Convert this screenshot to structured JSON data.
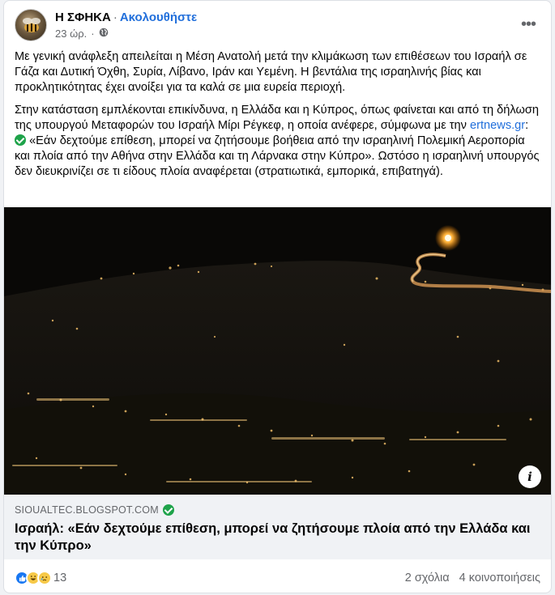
{
  "post": {
    "page_name": "Η ΣΦΗΚΑ",
    "separator": "·",
    "follow_label": "Ακολουθήστε",
    "time": "23 ώρ.",
    "privacy_icon": "globe-icon",
    "more_icon": "more-options-icon",
    "paragraph_1": "Με γενική ανάφλεξη απειλείται η Μέση Ανατολή μετά την κλιμάκωση των επιθέσεων του Ισραήλ σε Γάζα και Δυτική Όχθη, Συρία, Λίβανο, Ιράν και Υεμένη. Η βεντάλια της ισραηλινής βίας και προκλητικότητας έχει ανοίξει για τα καλά σε μια ευρεία περιοχή.",
    "paragraph_2_start": "Στην κατάσταση εμπλέκονται επικίνδυνα, η Ελλάδα και η Κύπρος, όπως φαίνεται και από τη δήλωση της υπουργού Μεταφορών του Ισραήλ Μίρι Ρέγκεφ, η οποία ανέφερε, σύμφωνα με την",
    "paragraph_2_link": "ertnews.gr",
    "paragraph_2_colon": ":",
    "paragraph_2_end": "«Εάν δεχτούμε επίθεση, μπορεί να ζητήσουμε βοήθεια από την ισραηλινή Πολεμική Αεροπορία και πλοία από την Αθήνα στην Ελλάδα και τη Λάρνακα στην Κύπρο». Ωστόσο η ισραηλινή υπουργός δεν διευκρινίζει σε τι είδους πλοία αναφέρεται (στρατιωτικά, εμπορικά, επιβατηγά)."
  },
  "link_preview": {
    "domain": "SIOUALTEC.BLOGSPOT.COM",
    "title": "Ισραήλ: «Εάν δεχτούμε επίθεση, μπορεί να ζητήσουμε πλοία από την Ελλάδα και την Κύπρο»",
    "info_label": "i"
  },
  "footer": {
    "reaction_count": "13",
    "comments": "2 σχόλια",
    "shares": "4 κοινοποιήσεις"
  },
  "colors": {
    "accent": "#216fdb",
    "verified": "#1ea34a",
    "like": "#1877f2"
  }
}
